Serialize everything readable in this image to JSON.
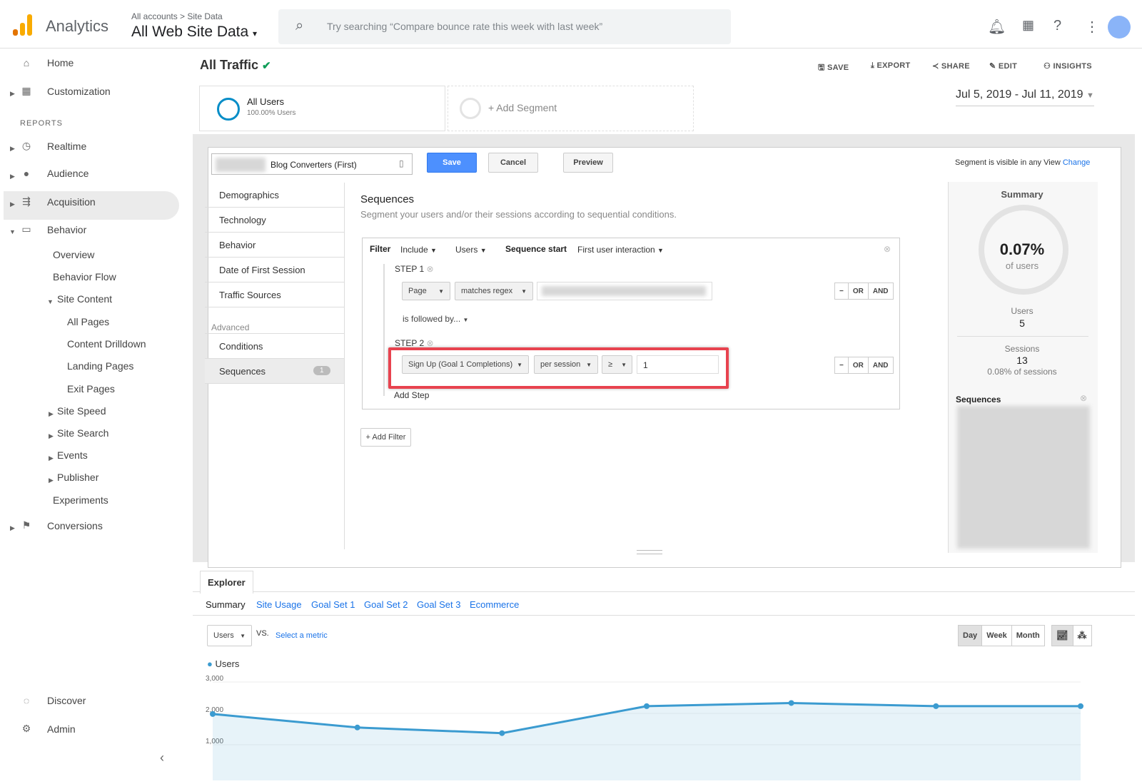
{
  "header": {
    "app_name": "Analytics",
    "breadcrumb": "All accounts > Site Data",
    "property": "All Web Site Data",
    "search_placeholder": "Try searching “Compare bounce rate this week with last week”"
  },
  "sidebar": {
    "home": "Home",
    "customization": "Customization",
    "reports_label": "REPORTS",
    "realtime": "Realtime",
    "audience": "Audience",
    "acquisition": "Acquisition",
    "behavior": "Behavior",
    "overview": "Overview",
    "behavior_flow": "Behavior Flow",
    "site_content": "Site Content",
    "all_pages": "All Pages",
    "content_drilldown": "Content Drilldown",
    "landing_pages": "Landing Pages",
    "exit_pages": "Exit Pages",
    "site_speed": "Site Speed",
    "site_search": "Site Search",
    "events": "Events",
    "publisher": "Publisher",
    "experiments": "Experiments",
    "conversions": "Conversions",
    "discover": "Discover",
    "admin": "Admin"
  },
  "toolbar": {
    "title": "All Traffic",
    "save": "SAVE",
    "export": "EXPORT",
    "share": "SHARE",
    "edit": "EDIT",
    "insights": "INSIGHTS",
    "date_range": "Jul 5, 2019 - Jul 11, 2019"
  },
  "segments": {
    "all_users": "All Users",
    "all_users_sub": "100.00% Users",
    "add_segment": "+ Add Segment"
  },
  "editor": {
    "segment_name": "Blog Converters (First)",
    "save": "Save",
    "cancel": "Cancel",
    "preview": "Preview",
    "visibility": "Segment is visible in any View",
    "change": "Change"
  },
  "categories": [
    "Demographics",
    "Technology",
    "Behavior",
    "Date of First Session",
    "Traffic Sources"
  ],
  "advanced_label": "Advanced",
  "advanced": {
    "conditions": "Conditions",
    "sequences": "Sequences",
    "sequences_count": "1"
  },
  "sequences": {
    "title": "Sequences",
    "description": "Segment your users and/or their sessions according to sequential conditions.",
    "filter": "Filter",
    "include": "Include",
    "users": "Users",
    "sequence_start": "Sequence start",
    "first_interaction": "First user interaction",
    "step1": "STEP 1",
    "page": "Page",
    "matches_regex": "matches regex",
    "followed_by": "is followed by...",
    "step2": "STEP 2",
    "goal": "Sign Up (Goal 1 Completions)",
    "per_session": "per session",
    "operator": "≥",
    "value": "1",
    "add_step": "Add Step",
    "add_filter": "+ Add Filter",
    "minus": "−",
    "or": "OR",
    "and": "AND"
  },
  "summary": {
    "title": "Summary",
    "percent": "0.07%",
    "of_users": "of users",
    "users_label": "Users",
    "users_value": "5",
    "sessions_label": "Sessions",
    "sessions_value": "13",
    "sessions_pct": "0.08% of sessions",
    "sequences_label": "Sequences"
  },
  "explorer": {
    "tab": "Explorer",
    "subtabs": [
      "Summary",
      "Site Usage",
      "Goal Set 1",
      "Goal Set 2",
      "Goal Set 3",
      "Ecommerce"
    ],
    "metric": "Users",
    "vs": "VS.",
    "select_metric": "Select a metric",
    "day": "Day",
    "week": "Week",
    "month": "Month"
  },
  "chart_data": {
    "type": "area",
    "series": [
      {
        "name": "Users",
        "values": [
          1980,
          1550,
          1370,
          2230,
          2330,
          2230,
          2230
        ]
      }
    ],
    "ylim": [
      0,
      3000
    ],
    "yticks": [
      "3,000",
      "2,000",
      "1,000"
    ],
    "color": "#3b9bd0"
  }
}
